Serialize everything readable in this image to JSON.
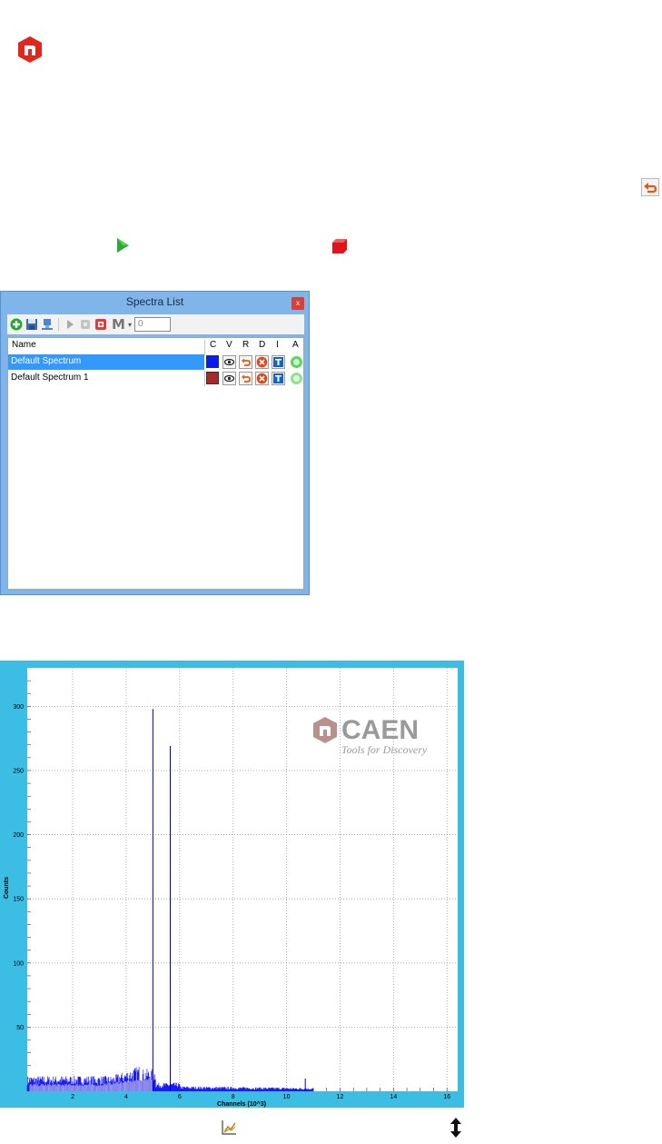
{
  "spectra_list": {
    "title": "Spectra List",
    "close": "x",
    "toolbar": {
      "m_label": "M",
      "m_arrow": "▾",
      "count_value": "0"
    },
    "columns": {
      "name": "Name",
      "c": "C",
      "v": "V",
      "r": "R",
      "d": "D",
      "i": "I",
      "a": "A"
    },
    "rows": [
      {
        "name": "Default Spectrum",
        "color": "#0a1cf5",
        "selected": true
      },
      {
        "name": "Default Spectrum 1",
        "color": "#a52a2a",
        "selected": false
      }
    ]
  },
  "logo": {
    "brand": "CAEN",
    "tagline": "Tools for Discovery"
  },
  "chart_data": {
    "type": "line",
    "xlabel": "Channels (10^3)",
    "ylabel": "Counts",
    "xlim": [
      0.3,
      16.4
    ],
    "ylim": [
      0,
      330
    ],
    "x_ticks": [
      "2",
      "4",
      "6",
      "8",
      "10",
      "12",
      "14",
      "16"
    ],
    "y_ticks": [
      "50",
      "100",
      "150",
      "200",
      "250",
      "300"
    ],
    "series": [
      {
        "color": "#0000ff",
        "peaks": [
          {
            "x": 5.0,
            "y": 298
          },
          {
            "x": 5.65,
            "y": 269
          },
          {
            "x": 10.7,
            "y": 10
          }
        ],
        "background_level": 10
      }
    ],
    "grid": true
  }
}
